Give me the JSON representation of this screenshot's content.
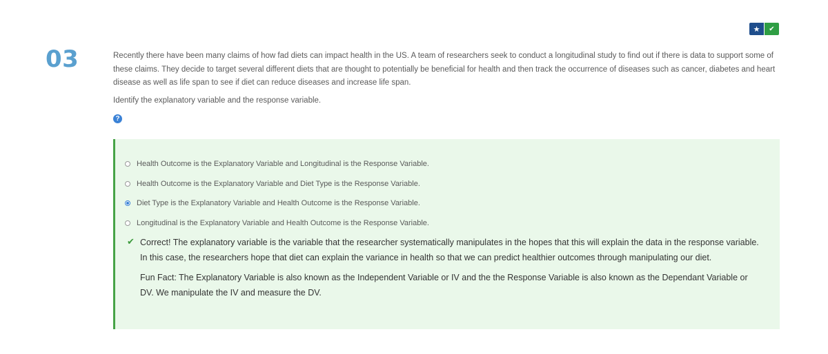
{
  "badges": {
    "star_icon": "★",
    "check_icon": "✔"
  },
  "question_number": "03",
  "question": {
    "text": "Recently there have been many claims of how fad diets can impact health in the US. A team of researchers seek to conduct a longitudinal study to find out if there is data to support some of these claims. They decide to target several different diets that are thought to potentially be beneficial for health and then track the occurrence of diseases such as cancer, diabetes and heart disease as well as life span to see if diet can reduce diseases and increase life span.",
    "prompt": "Identify the explanatory variable and the response variable.",
    "help_icon": "?"
  },
  "options": [
    {
      "label": "Health Outcome is the Explanatory Variable and Longitudinal is the Response Variable.",
      "selected": false
    },
    {
      "label": "Health Outcome is the Explanatory Variable and Diet Type is the Response Variable.",
      "selected": false
    },
    {
      "label": "Diet Type is the Explanatory Variable and Health Outcome is the Response Variable.",
      "selected": true
    },
    {
      "label": "Longitudinal is the Explanatory Variable and Health Outcome is the Response Variable.",
      "selected": false
    }
  ],
  "feedback": {
    "check_icon": "✔",
    "paragraph1": "Correct!  The explanatory variable is the variable that the researcher systematically manipulates in the hopes that this will explain the data in the response variable. In this case, the researchers hope that diet can explain the variance in health so that we can predict healthier outcomes through manipulating our diet.",
    "paragraph2": "Fun Fact: The Explanatory Variable is also known as the Independent Variable or IV and the the Response Variable is also known as the Dependant Variable or DV. We manipulate the IV and measure the DV."
  },
  "colors": {
    "question_number": "#5aa0cf",
    "feedback_bg": "#eaf8ea",
    "feedback_border": "#46a346",
    "star_badge": "#1f4e8c",
    "check_badge": "#2f9e44"
  }
}
